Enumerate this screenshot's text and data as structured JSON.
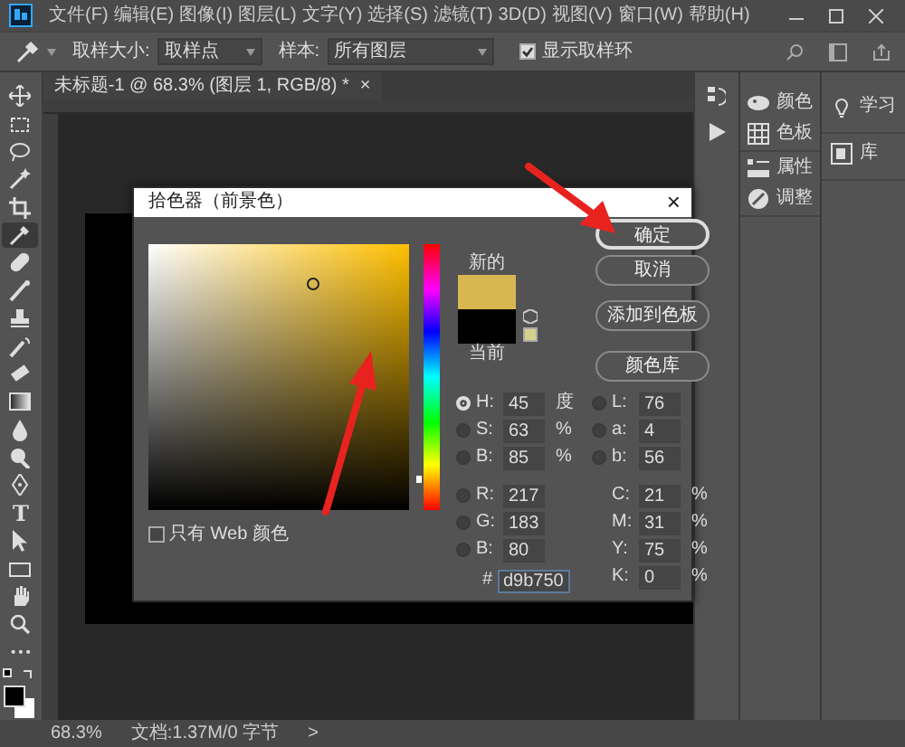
{
  "menu": [
    "文件(F)",
    "编辑(E)",
    "图像(I)",
    "图层(L)",
    "文字(Y)",
    "选择(S)",
    "滤镜(T)",
    "3D(D)",
    "视图(V)",
    "窗口(W)",
    "帮助(H)"
  ],
  "options_bar": {
    "sample_size_label": "取样大小:",
    "sample_size": "取样点",
    "sample_label": "样本:",
    "sample": "所有图层",
    "show_ring": {
      "label": "显示取样环",
      "checked": true
    }
  },
  "document_tab": {
    "title": "未标题-1 @ 68.3% (图层 1, RGB/8) *",
    "close": "×"
  },
  "tools": [
    {
      "kind": "move",
      "selected": false
    },
    {
      "kind": "marquee",
      "selected": false
    },
    {
      "kind": "lasso",
      "selected": false
    },
    {
      "kind": "wand",
      "selected": false
    },
    {
      "kind": "crop",
      "selected": false
    },
    {
      "kind": "eyedropper",
      "selected": true
    },
    {
      "kind": "bandage",
      "selected": false
    },
    {
      "kind": "brush",
      "selected": false
    },
    {
      "kind": "stamp",
      "selected": false
    },
    {
      "kind": "history",
      "selected": false
    },
    {
      "kind": "eraser",
      "selected": false
    },
    {
      "kind": "gradient",
      "selected": false
    },
    {
      "kind": "blur",
      "selected": false
    },
    {
      "kind": "dodge",
      "selected": false
    },
    {
      "kind": "pen",
      "selected": false
    },
    {
      "kind": "type",
      "glyph": "T",
      "selected": false
    },
    {
      "kind": "pointer",
      "selected": false
    },
    {
      "kind": "rectangle",
      "selected": false
    },
    {
      "kind": "hand",
      "selected": false
    },
    {
      "kind": "zoom",
      "selected": false
    },
    {
      "kind": "more",
      "glyph": "•••",
      "selected": false
    }
  ],
  "panels": [
    {
      "label": "颜色"
    },
    {
      "label": "色板"
    },
    {
      "label": "属性"
    },
    {
      "label": "调整"
    }
  ],
  "side_panels": [
    {
      "label": "学习"
    },
    {
      "label": "库"
    }
  ],
  "status_bar": {
    "zoom": "68.3%",
    "doc_info": "文档:1.37M/0 字节",
    "arrow": ">"
  },
  "dialog": {
    "title": "拾色器（前景色）",
    "close": "×",
    "swatches": [
      {
        "label": "新的",
        "color": "#d9b750"
      },
      {
        "label": "当前",
        "color": "#000000"
      }
    ],
    "buttons": [
      {
        "label": "确定",
        "default": true
      },
      {
        "label": "取消",
        "default": false
      },
      {
        "label": "添加到色板",
        "default": false
      },
      {
        "label": "颜色库",
        "default": false
      }
    ],
    "web_only": {
      "label": "只有 Web 颜色",
      "checked": false
    },
    "fields_left": [
      {
        "label": "H:",
        "value": "45",
        "unit": "度",
        "selected": true
      },
      {
        "label": "S:",
        "value": "63",
        "unit": "%",
        "selected": false
      },
      {
        "label": "B:",
        "value": "85",
        "unit": "%",
        "selected": false
      },
      {
        "label": "R:",
        "value": "217",
        "selected": false
      },
      {
        "label": "G:",
        "value": "183",
        "selected": false
      },
      {
        "label": "B:",
        "value": "80",
        "selected": false
      }
    ],
    "fields_right": [
      {
        "label": "L:",
        "value": "76",
        "radio": true,
        "selected": false
      },
      {
        "label": "a:",
        "value": "4",
        "radio": true,
        "selected": false
      },
      {
        "label": "b:",
        "value": "56",
        "radio": true,
        "selected": false
      },
      {
        "label": "C:",
        "value": "21",
        "unit": "%",
        "radio": false
      },
      {
        "label": "M:",
        "value": "31",
        "unit": "%",
        "radio": false
      },
      {
        "label": "Y:",
        "value": "75",
        "unit": "%",
        "radio": false
      },
      {
        "label": "K:",
        "value": "0",
        "unit": "%",
        "radio": false
      }
    ],
    "hex": {
      "label": "#",
      "value": "d9b750"
    }
  }
}
